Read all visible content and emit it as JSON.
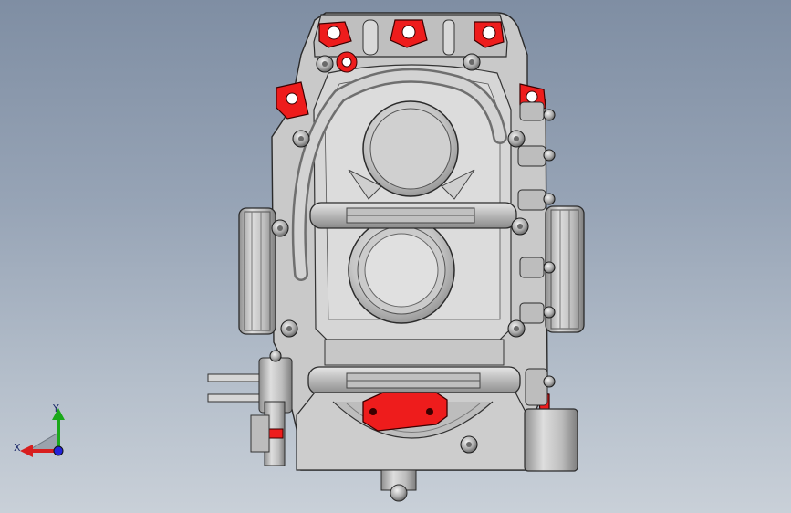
{
  "triad": {
    "x_label": "X",
    "y_label": "Y",
    "x_color": "#d81e1e",
    "y_color": "#1aa81a",
    "z_color": "#2323d9"
  },
  "colors": {
    "accent": "#ee1c1c",
    "metal": "#c4c4c4",
    "background_top": "#7f8ea3",
    "background_bottom": "#c9d0d8"
  }
}
